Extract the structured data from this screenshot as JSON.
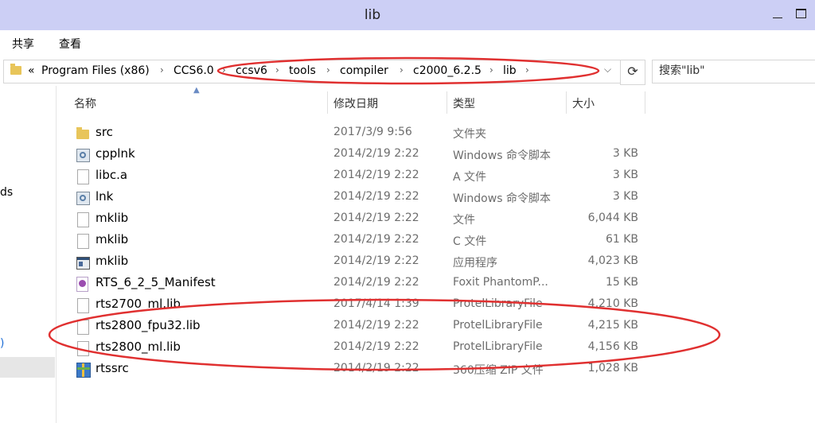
{
  "window": {
    "title": "lib"
  },
  "menu": {
    "share": "共享",
    "view": "查看"
  },
  "address": {
    "overflow": "«",
    "crumbs": [
      "Program Files (x86)",
      "CCS6.0",
      "ccsv6",
      "tools",
      "compiler",
      "c2000_6.2.5",
      "lib"
    ],
    "dropdown": "⌵"
  },
  "refresh": "⟳",
  "search": {
    "placeholder": "搜索\"lib\""
  },
  "navpane": {
    "frag1": "ds",
    "frag2": ")"
  },
  "columns": {
    "name": "名称",
    "date": "修改日期",
    "type": "类型",
    "size": "大小"
  },
  "files": [
    {
      "icon": "folder-icon",
      "name": "src",
      "date": "2017/3/9 9:56",
      "type": "文件夹",
      "size": ""
    },
    {
      "icon": "cmd-script-icon",
      "name": "cpplnk",
      "date": "2014/2/19 2:22",
      "type": "Windows 命令脚本",
      "size": "3 KB"
    },
    {
      "icon": "file-icon",
      "name": "libc.a",
      "date": "2014/2/19 2:22",
      "type": "A 文件",
      "size": "3 KB"
    },
    {
      "icon": "cmd-script-icon",
      "name": "lnk",
      "date": "2014/2/19 2:22",
      "type": "Windows 命令脚本",
      "size": "3 KB"
    },
    {
      "icon": "file-icon",
      "name": "mklib",
      "date": "2014/2/19 2:22",
      "type": "文件",
      "size": "6,044 KB"
    },
    {
      "icon": "file-icon",
      "name": "mklib",
      "date": "2014/2/19 2:22",
      "type": "C 文件",
      "size": "61 KB"
    },
    {
      "icon": "application-icon",
      "name": "mklib",
      "date": "2014/2/19 2:22",
      "type": "应用程序",
      "size": "4,023 KB"
    },
    {
      "icon": "pdf-icon",
      "name": "RTS_6_2_5_Manifest",
      "date": "2014/2/19 2:22",
      "type": "Foxit PhantomP...",
      "size": "15 KB"
    },
    {
      "icon": "file-icon",
      "name": "rts2700_ml.lib",
      "date": "2017/4/14 1:39",
      "type": "ProtelLibraryFile",
      "size": "4,210 KB"
    },
    {
      "icon": "file-icon",
      "name": "rts2800_fpu32.lib",
      "date": "2014/2/19 2:22",
      "type": "ProtelLibraryFile",
      "size": "4,215 KB"
    },
    {
      "icon": "file-icon",
      "name": "rts2800_ml.lib",
      "date": "2014/2/19 2:22",
      "type": "ProtelLibraryFile",
      "size": "4,156 KB"
    },
    {
      "icon": "zip-archive-icon",
      "name": "rtssrc",
      "date": "2014/2/19 2:22",
      "type": "360压缩 ZIP 文件",
      "size": "1,028 KB"
    }
  ],
  "colors": {
    "titlebar": "#cccff5",
    "annotation": "#e03030",
    "secondary_text": "#6d6d6d"
  }
}
